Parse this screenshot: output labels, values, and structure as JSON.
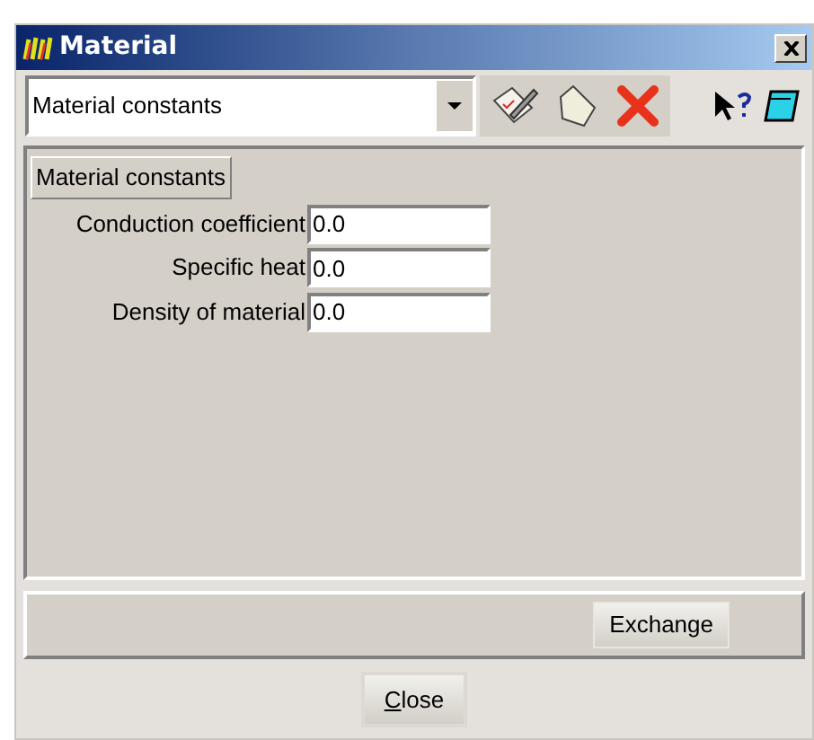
{
  "window": {
    "title": "Material"
  },
  "toolbar": {
    "selector": {
      "value": "Material constants"
    }
  },
  "group": {
    "tab": "Material constants",
    "fields": [
      {
        "label": "Conduction coefficient",
        "value": "0.0"
      },
      {
        "label": "Specific heat",
        "value": "0.0"
      },
      {
        "label": "Density of material",
        "value": "0.0"
      }
    ]
  },
  "action_bar": {
    "button": "Exchange"
  },
  "footer": {
    "button": {
      "label": "Close",
      "mnemonic_underlined": true
    }
  }
}
